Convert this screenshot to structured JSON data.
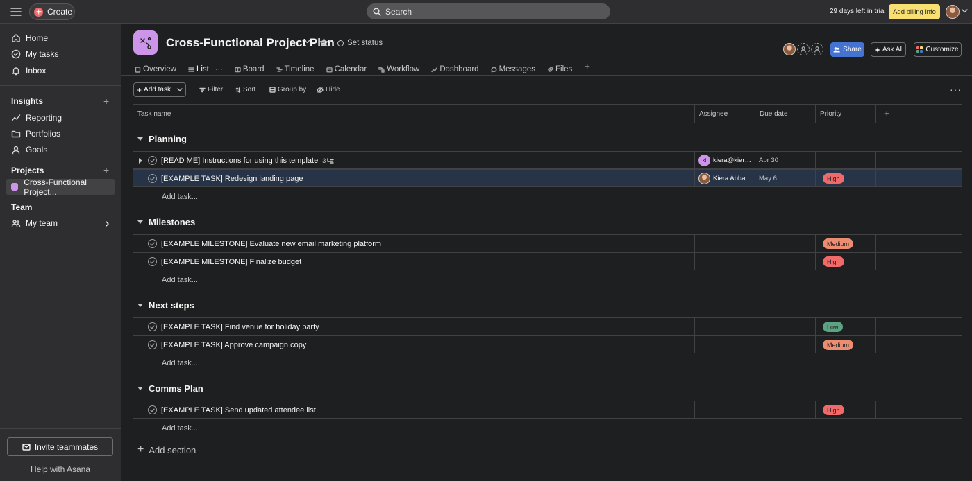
{
  "topbar": {
    "create_label": "Create",
    "search_label": "Search",
    "trial_text": "29 days left in trial",
    "billing_label": "Add billing info"
  },
  "sidebar": {
    "nav": [
      {
        "label": "Home",
        "icon": "home-icon"
      },
      {
        "label": "My tasks",
        "icon": "check-circle-icon"
      },
      {
        "label": "Inbox",
        "icon": "bell-icon"
      }
    ],
    "insights_heading": "Insights",
    "insights": [
      {
        "label": "Reporting",
        "icon": "line-chart-icon"
      },
      {
        "label": "Portfolios",
        "icon": "folder-icon"
      },
      {
        "label": "Goals",
        "icon": "person-goal-icon"
      }
    ],
    "projects_heading": "Projects",
    "project_item": "Cross-Functional Project...",
    "team_heading": "Team",
    "team_item": "My team",
    "invite_label": "Invite teammates",
    "help_label": "Help with Asana"
  },
  "project": {
    "title": "Cross-Functional Project Plan",
    "set_status": "Set status",
    "share_label": "Share",
    "askai_label": "Ask AI",
    "customize_label": "Customize",
    "tabs": [
      "Overview",
      "List",
      "Board",
      "Timeline",
      "Calendar",
      "Workflow",
      "Dashboard",
      "Messages",
      "Files"
    ],
    "active_tab": "List"
  },
  "toolbar": {
    "add_task": "Add task",
    "filter": "Filter",
    "sort": "Sort",
    "group_by": "Group by",
    "hide": "Hide"
  },
  "table": {
    "columns": [
      "Task name",
      "Assignee",
      "Due date",
      "Priority"
    ],
    "add_task_link": "Add task...",
    "add_section": "Add section",
    "sections": [
      {
        "name": "Planning",
        "tasks": [
          {
            "name": "[READ ME] Instructions for using this template",
            "subtasks": "3",
            "assignee": "kiera@kiera...",
            "assignee_initials": "ki",
            "due": "Apr 30",
            "priority": ""
          },
          {
            "name": "[EXAMPLE TASK] Redesign landing page",
            "assignee": "Kiera Abba...",
            "due": "May 6",
            "priority": "High"
          }
        ]
      },
      {
        "name": "Milestones",
        "tasks": [
          {
            "name": "[EXAMPLE MILESTONE] Evaluate new email marketing platform",
            "priority": "Medium"
          },
          {
            "name": "[EXAMPLE MILESTONE] Finalize budget",
            "priority": "High"
          }
        ]
      },
      {
        "name": "Next steps",
        "tasks": [
          {
            "name": "[EXAMPLE TASK] Find venue for holiday party",
            "priority": "Low"
          },
          {
            "name": "[EXAMPLE TASK] Approve campaign copy",
            "priority": "Medium"
          }
        ]
      },
      {
        "name": "Comms Plan",
        "tasks": [
          {
            "name": "[EXAMPLE TASK] Send updated attendee list",
            "priority": "High"
          }
        ]
      }
    ]
  },
  "colors": {
    "high": "#f06a6a",
    "medium": "#ec8d71",
    "low": "#5da283",
    "project": "#cd95ea",
    "share": "#4573d2",
    "billing": "#f8df72"
  }
}
